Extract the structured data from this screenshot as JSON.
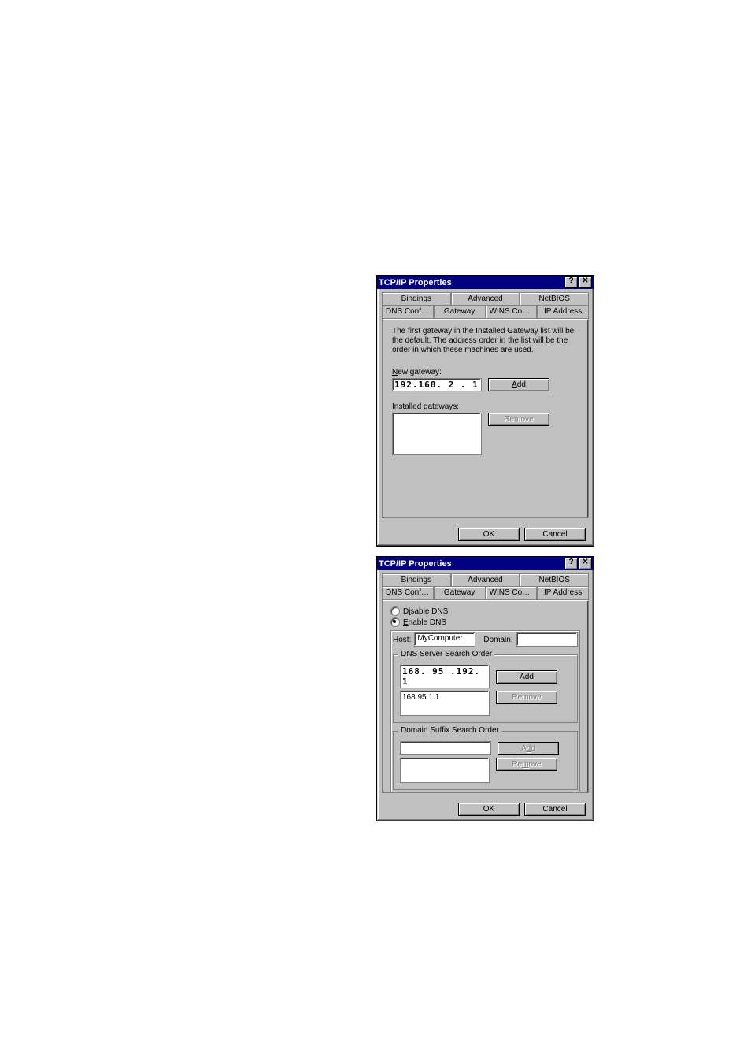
{
  "dialog1": {
    "title": "TCP/IP Properties",
    "tabs_row1": [
      "Bindings",
      "Advanced",
      "NetBIOS"
    ],
    "tabs_row2": [
      "DNS Configuration",
      "Gateway",
      "WINS Configuration",
      "IP Address"
    ],
    "active_tab_row2": "Gateway",
    "helptext": "The first gateway in the Installed Gateway list will be the default. The address order in the list will be the order in which these machines are used.",
    "new_gateway_label": "New gateway:",
    "new_gateway_value": "192.168. 2 . 1",
    "add_btn": "Add",
    "installed_label": "Installed gateways:",
    "installed_items": [],
    "remove_btn": "Remove",
    "ok": "OK",
    "cancel": "Cancel"
  },
  "dialog2": {
    "title": "TCP/IP Properties",
    "tabs_row1": [
      "Bindings",
      "Advanced",
      "NetBIOS"
    ],
    "tabs_row2": [
      "DNS Configuration",
      "Gateway",
      "WINS Configuration",
      "IP Address"
    ],
    "active_tab_row2": "DNS Configuration",
    "radio_disable": "Disable DNS",
    "radio_enable": "Enable DNS",
    "radio_selected": "enable",
    "host_label": "Host:",
    "host_value": "MyComputer",
    "domain_label": "Domain:",
    "domain_value": "",
    "dns_order_label": "DNS Server Search Order",
    "dns_new_value": "168. 95 .192. 1",
    "dns_list_items": [
      "168.95.1.1"
    ],
    "dns_add_btn": "Add",
    "dns_remove_btn": "Remove",
    "suffix_label": "Domain Suffix Search Order",
    "suffix_new_value": "",
    "suffix_list_items": [],
    "suffix_add_btn": "Add",
    "suffix_remove_btn": "Remove",
    "ok": "OK",
    "cancel": "Cancel"
  }
}
